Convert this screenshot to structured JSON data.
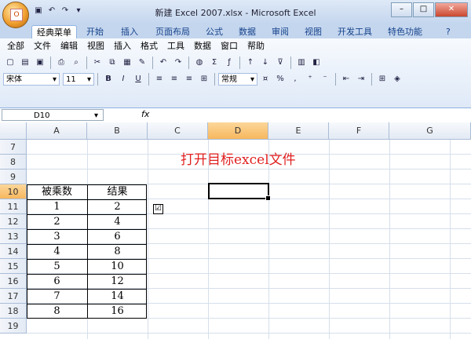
{
  "window": {
    "title": "新建 Excel 2007.xlsx - Microsoft Excel",
    "office_button": "O"
  },
  "tabs": [
    "经典菜单",
    "开始",
    "插入",
    "页面布局",
    "公式",
    "数据",
    "审阅",
    "视图",
    "开发工具",
    "特色功能"
  ],
  "active_tab": "经典菜单",
  "classic_menu": [
    "全部",
    "文件",
    "编辑",
    "视图",
    "插入",
    "格式",
    "工具",
    "数据",
    "窗口",
    "帮助"
  ],
  "toolbar": {
    "font_name": "宋体",
    "font_size": "11",
    "number_format": "常规",
    "bold": "B",
    "italic": "I",
    "underline": "U",
    "sum": "Σ",
    "percent": "%",
    "comma": ","
  },
  "formula_bar": {
    "name_box": "D10",
    "fx": "fx",
    "value": ""
  },
  "columns": [
    "A",
    "B",
    "C",
    "D",
    "E",
    "F",
    "G"
  ],
  "selected_column": "D",
  "rows": [
    "7",
    "8",
    "9",
    "10",
    "11",
    "12",
    "13",
    "14",
    "15",
    "16",
    "17",
    "18",
    "19"
  ],
  "selected_row": "10",
  "annotation": "打开目标excel文件",
  "table": {
    "header": [
      "被乘数",
      "结果"
    ],
    "data": [
      [
        "1",
        "2"
      ],
      [
        "2",
        "4"
      ],
      [
        "3",
        "6"
      ],
      [
        "4",
        "8"
      ],
      [
        "5",
        "10"
      ],
      [
        "6",
        "12"
      ],
      [
        "7",
        "14"
      ],
      [
        "8",
        "16"
      ]
    ]
  },
  "checkbox_glyph": "☑"
}
